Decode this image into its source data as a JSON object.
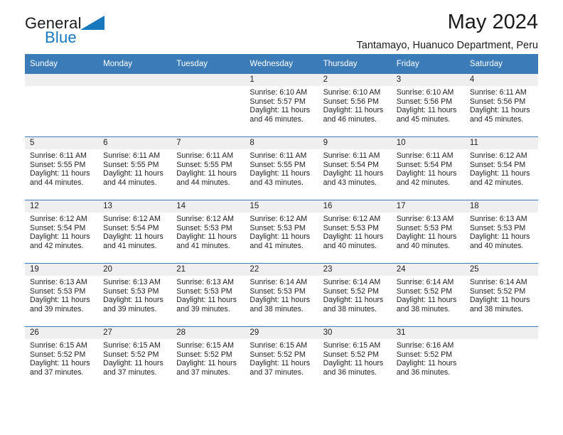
{
  "brand": {
    "line1": "General",
    "line2": "Blue",
    "logo_icon": "triangle-flag-icon",
    "accent_color": "#1878be"
  },
  "header": {
    "month_title": "May 2024",
    "location": "Tantamayo, Huanuco Department, Peru"
  },
  "calendar": {
    "header_bg": "#3b7cb8",
    "daynum_bg": "#efefef",
    "weekday_headers": [
      "Sunday",
      "Monday",
      "Tuesday",
      "Wednesday",
      "Thursday",
      "Friday",
      "Saturday"
    ],
    "weeks": [
      [
        {
          "day": "",
          "sunrise": "",
          "sunset": "",
          "daylight_line1": "",
          "daylight_line2": ""
        },
        {
          "day": "",
          "sunrise": "",
          "sunset": "",
          "daylight_line1": "",
          "daylight_line2": ""
        },
        {
          "day": "",
          "sunrise": "",
          "sunset": "",
          "daylight_line1": "",
          "daylight_line2": ""
        },
        {
          "day": "1",
          "sunrise": "Sunrise: 6:10 AM",
          "sunset": "Sunset: 5:57 PM",
          "daylight_line1": "Daylight: 11 hours",
          "daylight_line2": "and 46 minutes."
        },
        {
          "day": "2",
          "sunrise": "Sunrise: 6:10 AM",
          "sunset": "Sunset: 5:56 PM",
          "daylight_line1": "Daylight: 11 hours",
          "daylight_line2": "and 46 minutes."
        },
        {
          "day": "3",
          "sunrise": "Sunrise: 6:10 AM",
          "sunset": "Sunset: 5:56 PM",
          "daylight_line1": "Daylight: 11 hours",
          "daylight_line2": "and 45 minutes."
        },
        {
          "day": "4",
          "sunrise": "Sunrise: 6:11 AM",
          "sunset": "Sunset: 5:56 PM",
          "daylight_line1": "Daylight: 11 hours",
          "daylight_line2": "and 45 minutes."
        }
      ],
      [
        {
          "day": "5",
          "sunrise": "Sunrise: 6:11 AM",
          "sunset": "Sunset: 5:55 PM",
          "daylight_line1": "Daylight: 11 hours",
          "daylight_line2": "and 44 minutes."
        },
        {
          "day": "6",
          "sunrise": "Sunrise: 6:11 AM",
          "sunset": "Sunset: 5:55 PM",
          "daylight_line1": "Daylight: 11 hours",
          "daylight_line2": "and 44 minutes."
        },
        {
          "day": "7",
          "sunrise": "Sunrise: 6:11 AM",
          "sunset": "Sunset: 5:55 PM",
          "daylight_line1": "Daylight: 11 hours",
          "daylight_line2": "and 44 minutes."
        },
        {
          "day": "8",
          "sunrise": "Sunrise: 6:11 AM",
          "sunset": "Sunset: 5:55 PM",
          "daylight_line1": "Daylight: 11 hours",
          "daylight_line2": "and 43 minutes."
        },
        {
          "day": "9",
          "sunrise": "Sunrise: 6:11 AM",
          "sunset": "Sunset: 5:54 PM",
          "daylight_line1": "Daylight: 11 hours",
          "daylight_line2": "and 43 minutes."
        },
        {
          "day": "10",
          "sunrise": "Sunrise: 6:11 AM",
          "sunset": "Sunset: 5:54 PM",
          "daylight_line1": "Daylight: 11 hours",
          "daylight_line2": "and 42 minutes."
        },
        {
          "day": "11",
          "sunrise": "Sunrise: 6:12 AM",
          "sunset": "Sunset: 5:54 PM",
          "daylight_line1": "Daylight: 11 hours",
          "daylight_line2": "and 42 minutes."
        }
      ],
      [
        {
          "day": "12",
          "sunrise": "Sunrise: 6:12 AM",
          "sunset": "Sunset: 5:54 PM",
          "daylight_line1": "Daylight: 11 hours",
          "daylight_line2": "and 42 minutes."
        },
        {
          "day": "13",
          "sunrise": "Sunrise: 6:12 AM",
          "sunset": "Sunset: 5:54 PM",
          "daylight_line1": "Daylight: 11 hours",
          "daylight_line2": "and 41 minutes."
        },
        {
          "day": "14",
          "sunrise": "Sunrise: 6:12 AM",
          "sunset": "Sunset: 5:53 PM",
          "daylight_line1": "Daylight: 11 hours",
          "daylight_line2": "and 41 minutes."
        },
        {
          "day": "15",
          "sunrise": "Sunrise: 6:12 AM",
          "sunset": "Sunset: 5:53 PM",
          "daylight_line1": "Daylight: 11 hours",
          "daylight_line2": "and 41 minutes."
        },
        {
          "day": "16",
          "sunrise": "Sunrise: 6:12 AM",
          "sunset": "Sunset: 5:53 PM",
          "daylight_line1": "Daylight: 11 hours",
          "daylight_line2": "and 40 minutes."
        },
        {
          "day": "17",
          "sunrise": "Sunrise: 6:13 AM",
          "sunset": "Sunset: 5:53 PM",
          "daylight_line1": "Daylight: 11 hours",
          "daylight_line2": "and 40 minutes."
        },
        {
          "day": "18",
          "sunrise": "Sunrise: 6:13 AM",
          "sunset": "Sunset: 5:53 PM",
          "daylight_line1": "Daylight: 11 hours",
          "daylight_line2": "and 40 minutes."
        }
      ],
      [
        {
          "day": "19",
          "sunrise": "Sunrise: 6:13 AM",
          "sunset": "Sunset: 5:53 PM",
          "daylight_line1": "Daylight: 11 hours",
          "daylight_line2": "and 39 minutes."
        },
        {
          "day": "20",
          "sunrise": "Sunrise: 6:13 AM",
          "sunset": "Sunset: 5:53 PM",
          "daylight_line1": "Daylight: 11 hours",
          "daylight_line2": "and 39 minutes."
        },
        {
          "day": "21",
          "sunrise": "Sunrise: 6:13 AM",
          "sunset": "Sunset: 5:53 PM",
          "daylight_line1": "Daylight: 11 hours",
          "daylight_line2": "and 39 minutes."
        },
        {
          "day": "22",
          "sunrise": "Sunrise: 6:14 AM",
          "sunset": "Sunset: 5:53 PM",
          "daylight_line1": "Daylight: 11 hours",
          "daylight_line2": "and 38 minutes."
        },
        {
          "day": "23",
          "sunrise": "Sunrise: 6:14 AM",
          "sunset": "Sunset: 5:52 PM",
          "daylight_line1": "Daylight: 11 hours",
          "daylight_line2": "and 38 minutes."
        },
        {
          "day": "24",
          "sunrise": "Sunrise: 6:14 AM",
          "sunset": "Sunset: 5:52 PM",
          "daylight_line1": "Daylight: 11 hours",
          "daylight_line2": "and 38 minutes."
        },
        {
          "day": "25",
          "sunrise": "Sunrise: 6:14 AM",
          "sunset": "Sunset: 5:52 PM",
          "daylight_line1": "Daylight: 11 hours",
          "daylight_line2": "and 38 minutes."
        }
      ],
      [
        {
          "day": "26",
          "sunrise": "Sunrise: 6:15 AM",
          "sunset": "Sunset: 5:52 PM",
          "daylight_line1": "Daylight: 11 hours",
          "daylight_line2": "and 37 minutes."
        },
        {
          "day": "27",
          "sunrise": "Sunrise: 6:15 AM",
          "sunset": "Sunset: 5:52 PM",
          "daylight_line1": "Daylight: 11 hours",
          "daylight_line2": "and 37 minutes."
        },
        {
          "day": "28",
          "sunrise": "Sunrise: 6:15 AM",
          "sunset": "Sunset: 5:52 PM",
          "daylight_line1": "Daylight: 11 hours",
          "daylight_line2": "and 37 minutes."
        },
        {
          "day": "29",
          "sunrise": "Sunrise: 6:15 AM",
          "sunset": "Sunset: 5:52 PM",
          "daylight_line1": "Daylight: 11 hours",
          "daylight_line2": "and 37 minutes."
        },
        {
          "day": "30",
          "sunrise": "Sunrise: 6:15 AM",
          "sunset": "Sunset: 5:52 PM",
          "daylight_line1": "Daylight: 11 hours",
          "daylight_line2": "and 36 minutes."
        },
        {
          "day": "31",
          "sunrise": "Sunrise: 6:16 AM",
          "sunset": "Sunset: 5:52 PM",
          "daylight_line1": "Daylight: 11 hours",
          "daylight_line2": "and 36 minutes."
        },
        {
          "day": "",
          "sunrise": "",
          "sunset": "",
          "daylight_line1": "",
          "daylight_line2": ""
        }
      ]
    ]
  }
}
